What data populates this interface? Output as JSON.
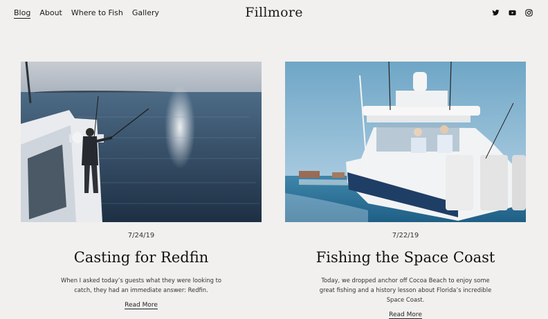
{
  "site": {
    "title": "Fillmore"
  },
  "nav": {
    "items": [
      {
        "label": "Blog"
      },
      {
        "label": "About"
      },
      {
        "label": "Where to Fish"
      },
      {
        "label": "Gallery"
      }
    ]
  },
  "social": {
    "icons": [
      "twitter-icon",
      "youtube-icon",
      "instagram-icon"
    ]
  },
  "posts": [
    {
      "date": "7/24/19",
      "title": "Casting for Redfin",
      "excerpt": "When I asked today’s guests what they were looking to catch, they had an immediate answer: Redfin.",
      "read_more": "Read More"
    },
    {
      "date": "7/22/19",
      "title": "Fishing the Space Coast",
      "excerpt": "Today, we dropped anchor off Cocoa Beach to enjoy some great fishing and a history lesson about Florida’s incredible Space Coast.",
      "read_more": "Read More"
    }
  ]
}
